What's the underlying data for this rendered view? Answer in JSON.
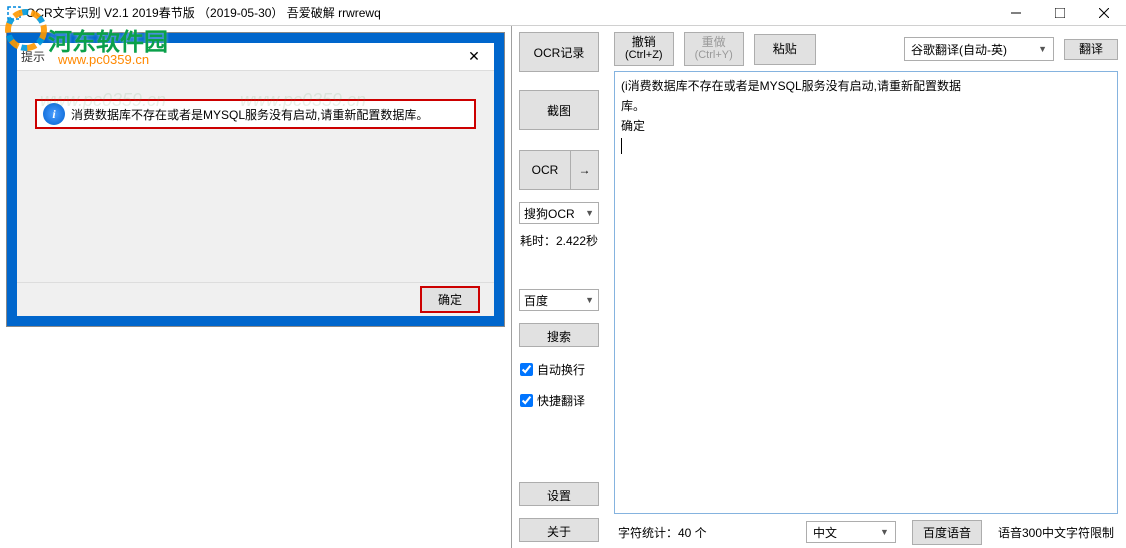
{
  "window": {
    "title": "OCR文字识别 V2.1    2019春节版  （2019-05-30）   吾爱破解 rrwrewq"
  },
  "watermark": {
    "site_name": "河东软件园",
    "url": "www.pc0359.cn"
  },
  "dialog": {
    "title": "提示",
    "message": "消费数据库不存在或者是MYSQL服务没有启动,请重新配置数据库。",
    "ok": "确定"
  },
  "mid": {
    "ocr_record": "OCR记录",
    "screenshot": "截图",
    "ocr": "OCR",
    "arrow": "→",
    "engine_select": "搜狗OCR",
    "timing": "耗时：2.422秒",
    "baidu": "百度",
    "search": "搜索",
    "auto_wrap": "自动换行",
    "quick_translate": "快捷翻译",
    "settings": "设置",
    "about": "关于"
  },
  "top": {
    "undo": "撤销",
    "undo_key": "(Ctrl+Z)",
    "redo": "重做",
    "redo_key": "(Ctrl+Y)",
    "paste": "粘贴",
    "translate_engine": "谷歌翻译(自动-英)",
    "translate": "翻译"
  },
  "output": {
    "text": "(i消费数据库不存在或者是MYSQL服务没有启动,请重新配置数据\n库。\n确定"
  },
  "bottom": {
    "stats": "字符统计：40 个",
    "lang": "中文",
    "voice": "百度语音",
    "voice_limit": "语音300中文字符限制"
  }
}
